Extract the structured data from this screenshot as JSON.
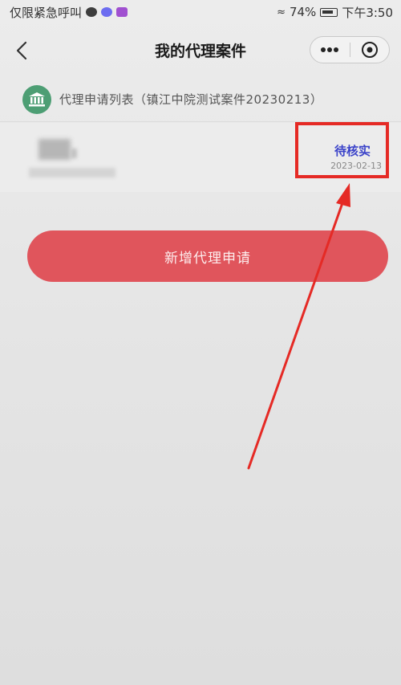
{
  "status_bar": {
    "carrier_text": "仅限紧急呼叫",
    "battery": "74%",
    "time": "下午3:50"
  },
  "navbar": {
    "title": "我的代理案件"
  },
  "list_header": {
    "text": "代理申请列表（镇江中院测试案件20230213）"
  },
  "case_item": {
    "status": "待核实",
    "date": "2023-02-13"
  },
  "actions": {
    "add_label": "新增代理申请"
  },
  "colors": {
    "status_text": "#3b43c9",
    "primary_button": "#e0555c",
    "highlight": "#e52a25",
    "court_icon": "#4d9e74"
  }
}
